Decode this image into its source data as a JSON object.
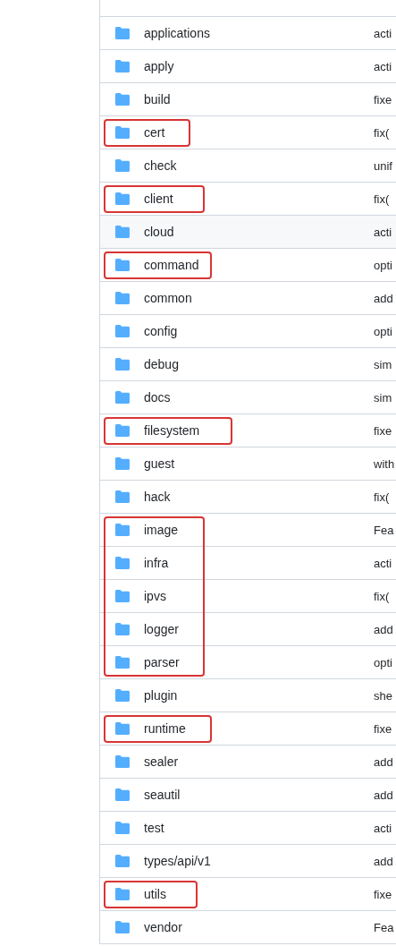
{
  "files": [
    {
      "name": "applications",
      "message": "acti",
      "hovered": false,
      "marked": false
    },
    {
      "name": "apply",
      "message": "acti",
      "hovered": false,
      "marked": false
    },
    {
      "name": "build",
      "message": "fixe",
      "hovered": false,
      "marked": false
    },
    {
      "name": "cert",
      "message": "fix(",
      "hovered": false,
      "marked": true
    },
    {
      "name": "check",
      "message": "unif",
      "hovered": false,
      "marked": false
    },
    {
      "name": "client",
      "message": "fix(",
      "hovered": false,
      "marked": true
    },
    {
      "name": "cloud",
      "message": "acti",
      "hovered": true,
      "marked": false
    },
    {
      "name": "command",
      "message": "opti",
      "hovered": false,
      "marked": true
    },
    {
      "name": "common",
      "message": "add",
      "hovered": false,
      "marked": false
    },
    {
      "name": "config",
      "message": "opti",
      "hovered": false,
      "marked": false
    },
    {
      "name": "debug",
      "message": "sim",
      "hovered": false,
      "marked": false
    },
    {
      "name": "docs",
      "message": "sim",
      "hovered": false,
      "marked": false
    },
    {
      "name": "filesystem",
      "message": "fixe",
      "hovered": false,
      "marked": true
    },
    {
      "name": "guest",
      "message": "with",
      "hovered": false,
      "marked": false
    },
    {
      "name": "hack",
      "message": "fix(",
      "hovered": false,
      "marked": false
    },
    {
      "name": "image",
      "message": "Fea",
      "hovered": false,
      "marked": true
    },
    {
      "name": "infra",
      "message": "acti",
      "hovered": false,
      "marked": true
    },
    {
      "name": "ipvs",
      "message": "fix(",
      "hovered": false,
      "marked": true
    },
    {
      "name": "logger",
      "message": "add",
      "hovered": false,
      "marked": true
    },
    {
      "name": "parser",
      "message": "opti",
      "hovered": false,
      "marked": true
    },
    {
      "name": "plugin",
      "message": "she",
      "hovered": false,
      "marked": false
    },
    {
      "name": "runtime",
      "message": "fixe",
      "hovered": false,
      "marked": true
    },
    {
      "name": "sealer",
      "message": "add",
      "hovered": false,
      "marked": false
    },
    {
      "name": "seautil",
      "message": "add",
      "hovered": false,
      "marked": false
    },
    {
      "name": "test",
      "message": "acti",
      "hovered": false,
      "marked": false
    },
    {
      "name": "types/api/v1",
      "message": "add",
      "hovered": false,
      "marked": false
    },
    {
      "name": "utils",
      "message": "fixe",
      "hovered": false,
      "marked": true
    },
    {
      "name": "vendor",
      "message": "Fea",
      "hovered": false,
      "marked": false
    }
  ]
}
